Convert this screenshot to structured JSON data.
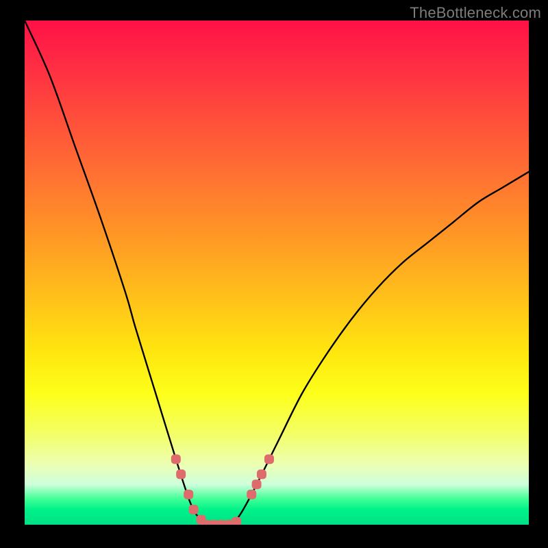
{
  "watermark": {
    "text": "TheBottleneck.com"
  },
  "colors": {
    "curve": "#000000",
    "markers": "#de6c6c",
    "background": "#000000"
  },
  "chart_data": {
    "type": "line",
    "title": "",
    "xlabel": "",
    "ylabel": "",
    "xlim": [
      0,
      100
    ],
    "ylim": [
      0,
      100
    ],
    "grid": false,
    "legend": false,
    "annotations": [],
    "series": [
      {
        "name": "bottleneck-curve",
        "x": [
          0,
          5,
          10,
          15,
          20,
          22,
          26,
          30,
          33,
          35,
          37,
          40,
          42,
          45,
          50,
          55,
          60,
          65,
          70,
          75,
          80,
          85,
          90,
          95,
          100
        ],
        "values": [
          100,
          89,
          75,
          61,
          46,
          39,
          26,
          13,
          4,
          1,
          0,
          0,
          1,
          6,
          16,
          26,
          34,
          41,
          47,
          52,
          56,
          60,
          64,
          67,
          70
        ]
      }
    ],
    "markers": {
      "name": "highlight-segments",
      "points": [
        {
          "x": 30,
          "y": 13
        },
        {
          "x": 31,
          "y": 10
        },
        {
          "x": 32.5,
          "y": 6
        },
        {
          "x": 33.5,
          "y": 3
        },
        {
          "x": 35,
          "y": 1
        },
        {
          "x": 36,
          "y": 0
        },
        {
          "x": 37.5,
          "y": 0
        },
        {
          "x": 39,
          "y": 0
        },
        {
          "x": 40.5,
          "y": 0
        },
        {
          "x": 42,
          "y": 0.6
        },
        {
          "x": 45,
          "y": 6
        },
        {
          "x": 46,
          "y": 8
        },
        {
          "x": 47,
          "y": 10
        },
        {
          "x": 48.5,
          "y": 13
        }
      ]
    }
  }
}
